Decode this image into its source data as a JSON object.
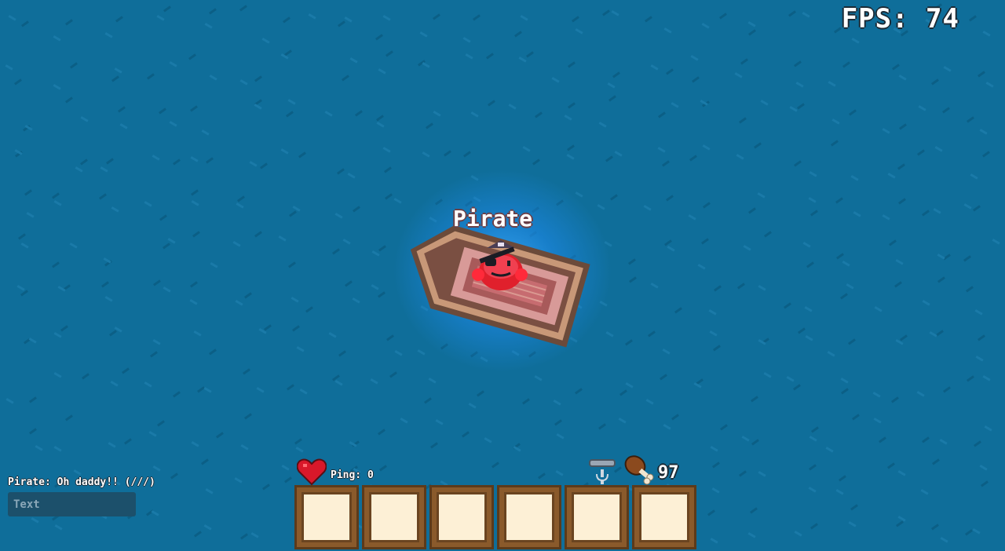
{
  "hud": {
    "fps_label": "FPS: 74"
  },
  "player": {
    "name": "Pirate",
    "icon": "pirate-blob-icon"
  },
  "chat": {
    "messages": [
      "Pirate: Oh daddy!! (///)"
    ],
    "input_placeholder": "Text",
    "input_value": ""
  },
  "status": {
    "health_icon": "heart-icon",
    "ping_label": "Ping: 0",
    "mic_icon": "microphone-icon",
    "hunger_icon": "meat-icon",
    "hunger_value": "97"
  },
  "hotbar": {
    "slots": [
      "",
      "",
      "",
      "",
      "",
      ""
    ]
  },
  "colors": {
    "water": "#0f6e9a",
    "slot_border": "#8a5a2b",
    "slot_fill": "#fdf0d6",
    "player_glow": "#3aa0ff",
    "heart": "#d8182a"
  }
}
